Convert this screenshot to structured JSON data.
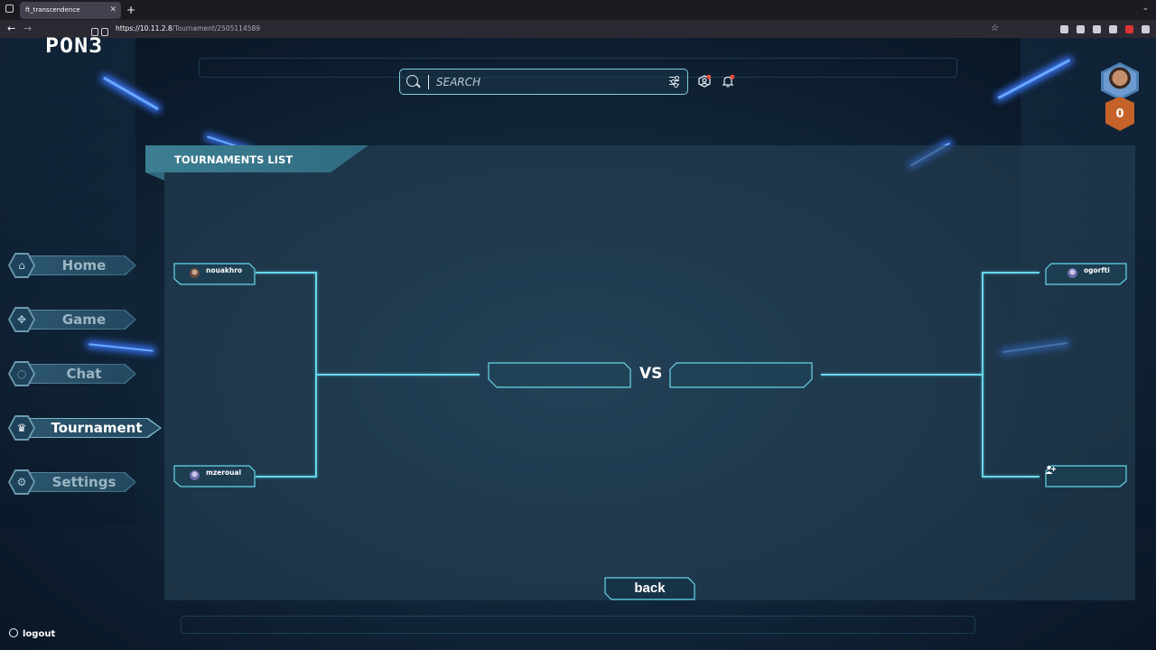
{
  "browser": {
    "tab_title": "ft_transcendence",
    "tab_close": "✕",
    "new_tab": "+",
    "url_host": "https://10.11.2.8",
    "url_path": "/Tournament/2505114589"
  },
  "header": {
    "logo": "PON3",
    "search_placeholder": "SEARCH",
    "level": "0"
  },
  "sidebar": {
    "items": [
      {
        "label": "Home",
        "icon": "home-icon"
      },
      {
        "label": "Game",
        "icon": "gamepad-icon"
      },
      {
        "label": "Chat",
        "icon": "chat-icon"
      },
      {
        "label": "Tournament",
        "icon": "trophy-icon",
        "active": true
      },
      {
        "label": "Settings",
        "icon": "gear-icon"
      }
    ],
    "logout": "logout"
  },
  "tournament": {
    "title": "TOURNAMENTS LIST",
    "players": {
      "left_top": "nouakhro",
      "left_bottom": "mzeroual",
      "right_top": "ogorfti",
      "right_bottom": ""
    },
    "vs": "VS",
    "back": "back"
  },
  "colors": {
    "accent": "#67d7ea",
    "badge": "#c4622a",
    "notification": "#e74c3c"
  }
}
